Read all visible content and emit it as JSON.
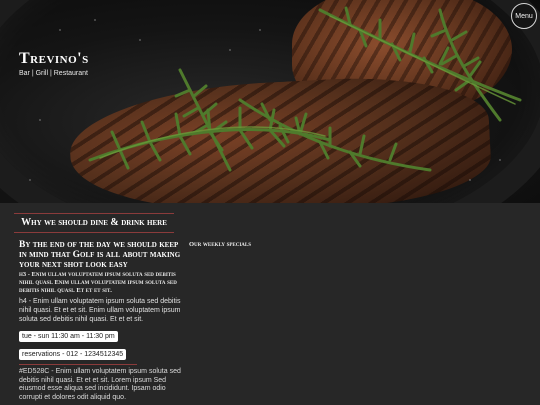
{
  "header": {
    "brand_name": "Trevino's",
    "tagline": "Bar | Grill | Restaurant",
    "menu_label": "Menu"
  },
  "main": {
    "section_title": "Why we should dine & drink here",
    "lead": "By the end of the day we should keep in mind that Golf is all about making your next shot look easy",
    "h3": "h3 - Enim ullam voluptatem ipsum soluta sed debitis nihil quasi. Enim ullam voluptatem ipsum soluta sed debitis nihil quasi. Et et et sit.",
    "h4": "h4 - Enim ullam voluptatem ipsum soluta sed debitis nihil quasi. Et et et sit. Enim ullam voluptatem ipsum soluta sed debitis nihil quasi. Et et et sit.",
    "hours": "tue - sun 11:30 am - 11:30 pm",
    "reservations": "reservations - 012 - 1234512345",
    "body": "#ED528C - Enim ullam voluptatem ipsum soluta sed debitis nihil quasi. Et et et sit. Lorem ipsum Sed eiusmod esse aliqua sed incididunt. Ipsam odio corrupti et dolores odit aliquid quo."
  },
  "sidebar": {
    "specials_title": "Our weekly specials"
  },
  "colors": {
    "accent_rule": "#8b3b3b",
    "background": "#272727"
  }
}
